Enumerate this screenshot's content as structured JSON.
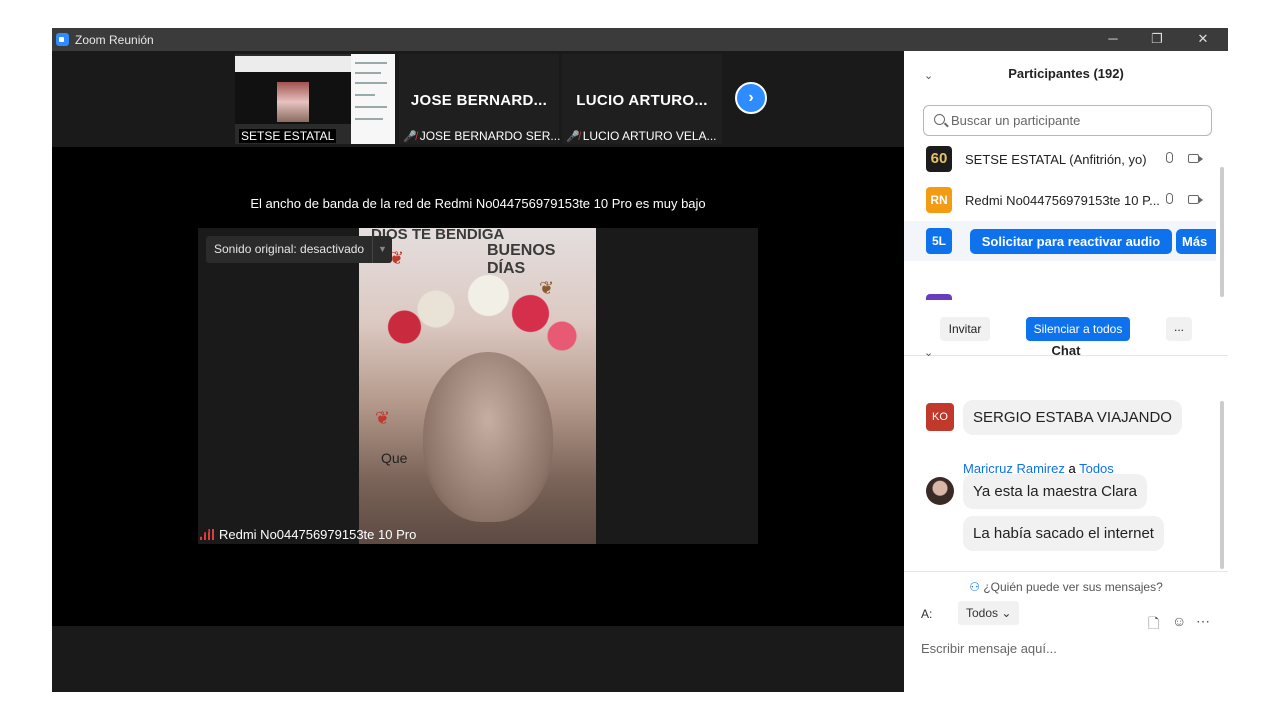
{
  "window": {
    "title": "Zoom Reunión",
    "controls": {
      "minimize": "─",
      "restore": "❐",
      "close": "✕"
    }
  },
  "thumbnails": [
    {
      "caption": "SETSE ESTATAL",
      "big_name": "",
      "muted": false
    },
    {
      "caption": "JOSE BERNARDO SER...",
      "big_name": "JOSE BERNARD...",
      "muted": true
    },
    {
      "caption": "LUCIO ARTURO VELA...",
      "big_name": "LUCIO ARTURO...",
      "muted": true
    }
  ],
  "next_arrow": "›",
  "bandwidth_notice": "El ancho de banda de la red de Redmi No044756979153te 10 Pro es muy bajo",
  "video": {
    "audio_button": "Sonido original: desactivado",
    "caption": "Redmi No044756979153te 10 Pro",
    "overlay_text_1": "DIOS TE BENDIGA",
    "overlay_text_2": "BUENOS DÍAS",
    "overlay_text_3": "Que"
  },
  "participants": {
    "header": "Participantes (192)",
    "search_placeholder": "Buscar un participante",
    "rows": [
      {
        "avatar": "60",
        "avatar_color": "#1c1c1c",
        "name": "SETSE ESTATAL (Anfitrión, yo)"
      },
      {
        "avatar": "RN",
        "avatar_color": "#f29b13",
        "name": "Redmi No044756979153te 10 P..."
      },
      {
        "avatar": "5L",
        "avatar_color": "#0e72ed",
        "name": ""
      }
    ],
    "request_audio_button": "Solicitar para reactivar audio",
    "more_button": "Más",
    "invite_button": "Invitar",
    "mute_all_button": "Silenciar a todos",
    "more_options": "..."
  },
  "chat": {
    "header": "Chat",
    "messages": [
      {
        "avatar": "KO",
        "avatar_color": "#c0392b",
        "text": "SERGIO ESTABA  VIAJANDO"
      },
      {
        "sender": "Maricruz Ramirez",
        "connector": "a",
        "target": "Todos",
        "text": "Ya esta la maestra Clara"
      },
      {
        "text": "La había sacado el internet"
      }
    ],
    "who_can_see": "¿Quién puede ver sus mensajes?",
    "to_label": "A:",
    "to_value": "Todos",
    "placeholder": "Escribir mensaje aquí..."
  }
}
